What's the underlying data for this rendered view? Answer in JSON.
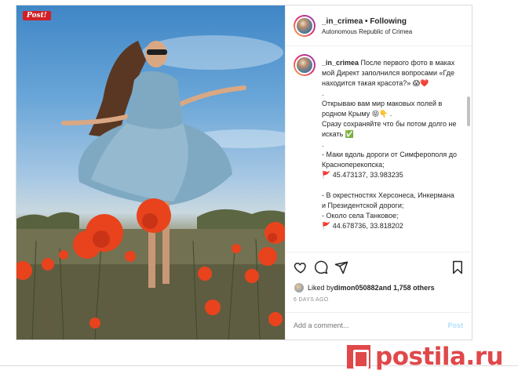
{
  "post": {
    "badge": "Post!",
    "username": "_in_crimea",
    "follow_status": "• Following",
    "location": "Autonomous Republic of Crimea"
  },
  "caption": {
    "username": "_in_crimea",
    "text": " После первого фото в маках мой Директ заполнился вопросами «Где находится такая красота?» 😱❤️\n.\nОткрываю вам мир маковых полей в родном Крыму 😝👇 .\nСразу сохраняйте что бы потом долго не искать ✅\n.\n- Маки вдоль дороги от Симферополя до Красноперекопска;\n🚩 45.473137, 33.983235\n\n- В окрестностях Херсонеса, Инкермана и Президентской дороги;\n- Около села Танковое;\n🚩 44.678736, 33.818202"
  },
  "actions": {
    "like_icon": "heart-icon",
    "comment_icon": "comment-icon",
    "share_icon": "share-icon",
    "save_icon": "bookmark-icon"
  },
  "likes": {
    "prefix": "Liked by ",
    "user": "dimon050882",
    "suffix": " and 1,758 others"
  },
  "date": "6 DAYS AGO",
  "comment": {
    "placeholder": "Add a comment...",
    "post_label": "Post"
  },
  "watermark": "postila.ru",
  "colors": {
    "accent_blue": "#b2dffc",
    "badge_red": "#d21f26",
    "watermark_red": "#e0484a"
  }
}
